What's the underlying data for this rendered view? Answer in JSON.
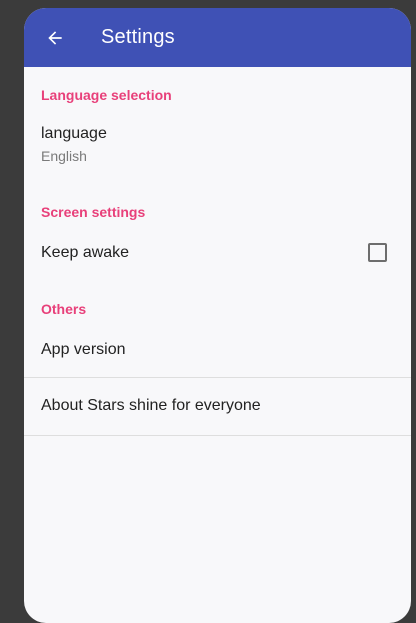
{
  "app_bar": {
    "title": "Settings",
    "background_color": "#3f51b5",
    "back_icon": "arrow-left-icon"
  },
  "sections": {
    "language": {
      "header": "Language selection",
      "item_title": "language",
      "item_summary": "English"
    },
    "screen": {
      "header": "Screen settings",
      "item_title": "Keep awake",
      "checked": false
    },
    "others": {
      "header": "Others",
      "app_version_title": "App version",
      "about_title": "About Stars shine for everyone"
    }
  },
  "colors": {
    "accent": "#e8407a",
    "background": "#f8f8fa"
  }
}
